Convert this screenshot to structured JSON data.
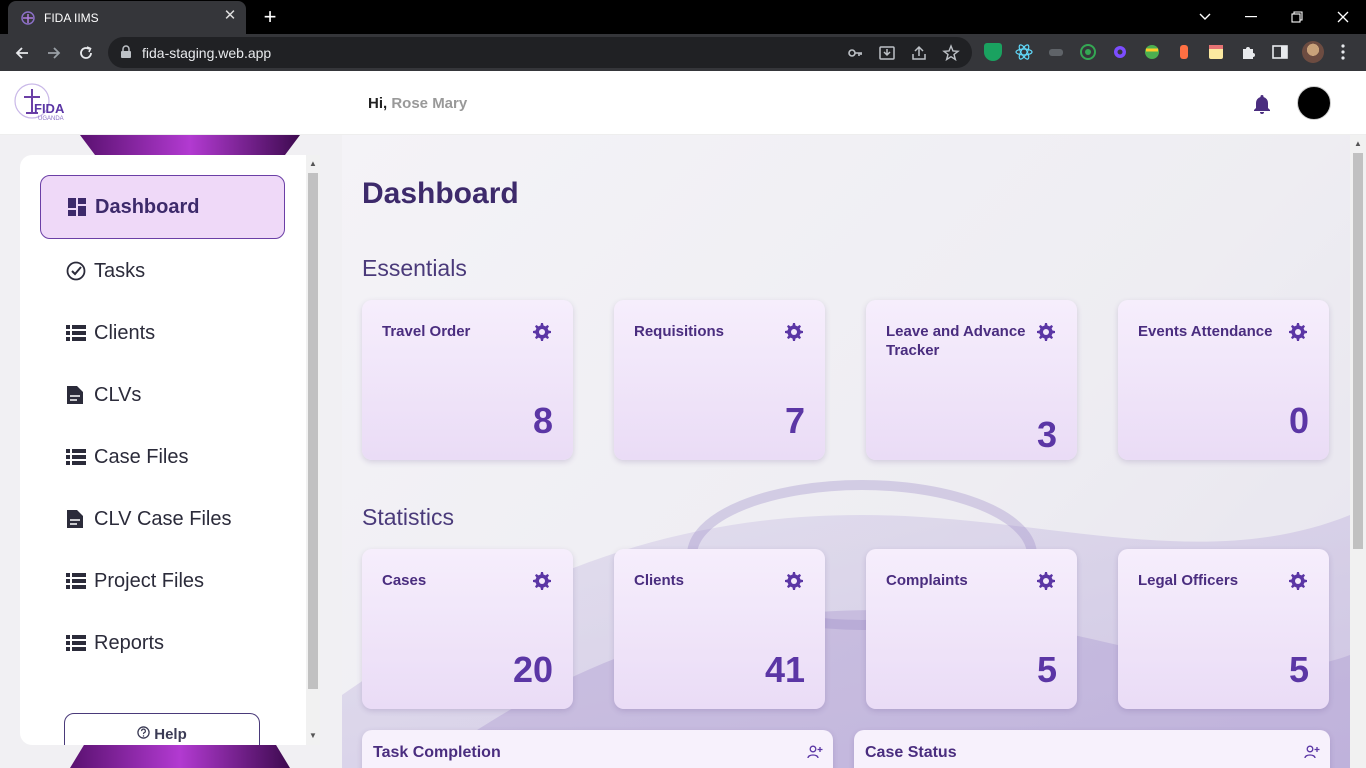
{
  "browser": {
    "tab_title": "FIDA IIMS",
    "url": "fida-staging.web.app"
  },
  "header": {
    "greeting": "Hi,",
    "user_name": "Rose Mary",
    "logo_text": "FIDA",
    "logo_subtext": "UGANDA"
  },
  "sidebar": {
    "items": [
      {
        "label": "Dashboard",
        "icon": "dashboard-icon"
      },
      {
        "label": "Tasks",
        "icon": "check-circle-icon"
      },
      {
        "label": "Clients",
        "icon": "list-icon"
      },
      {
        "label": "CLVs",
        "icon": "file-icon"
      },
      {
        "label": "Case Files",
        "icon": "list-icon"
      },
      {
        "label": "CLV Case Files",
        "icon": "file-icon"
      },
      {
        "label": "Project Files",
        "icon": "list-icon"
      },
      {
        "label": "Reports",
        "icon": "list-icon"
      }
    ],
    "help_label": "Help"
  },
  "main": {
    "title": "Dashboard",
    "essentials_heading": "Essentials",
    "essentials": [
      {
        "title": "Travel Order",
        "value": "8"
      },
      {
        "title": "Requisitions",
        "value": "7"
      },
      {
        "title": "Leave and Advance Tracker",
        "value": "3"
      },
      {
        "title": "Events Attendance",
        "value": "0"
      }
    ],
    "statistics_heading": "Statistics",
    "statistics": [
      {
        "title": "Cases",
        "value": "20"
      },
      {
        "title": "Clients",
        "value": "41"
      },
      {
        "title": "Complaints",
        "value": "5"
      },
      {
        "title": "Legal Officers",
        "value": "5"
      }
    ],
    "panels": [
      {
        "title": "Task Completion"
      },
      {
        "title": "Case Status"
      }
    ]
  },
  "colors": {
    "accent": "#5b36a5",
    "active_nav_bg": "#efd9f8",
    "card_title": "#4a2d7f"
  }
}
